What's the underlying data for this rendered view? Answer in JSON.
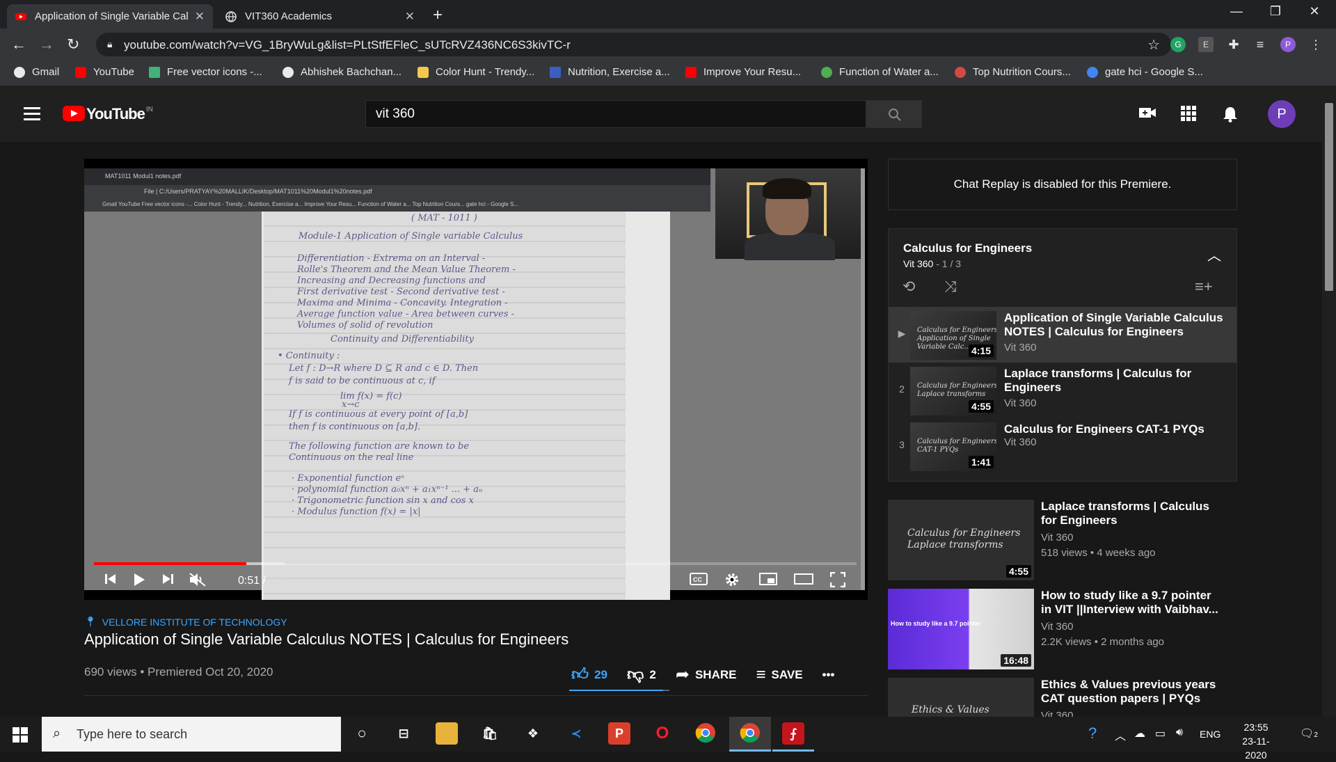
{
  "browser": {
    "tabs": [
      {
        "title": "Application of Single Variable Cal",
        "favicon": "youtube-icon",
        "active": true
      },
      {
        "title": "VIT360 Academics",
        "favicon": "globe-icon",
        "active": false
      }
    ],
    "new_tab": "+",
    "window_controls": {
      "minimize": "—",
      "maximize": "❐",
      "close": "✕"
    },
    "url": "youtube.com/watch?v=VG_1BryWuLg&list=PLtStfEFleC_sUTcRVZ436NC6S3kivTC-r",
    "extensions": [
      "G",
      "E"
    ],
    "profile_initial": "P",
    "bookmarks": [
      {
        "label": "Gmail",
        "color": "#e8eaed"
      },
      {
        "label": "YouTube",
        "color": "#ff0000"
      },
      {
        "label": "Free vector icons -...",
        "color": "#43b27a"
      },
      {
        "label": "Abhishek Bachchan...",
        "color": "#e8eaed"
      },
      {
        "label": "Color Hunt - Trendy...",
        "color": "#f2c94c"
      },
      {
        "label": "Nutrition, Exercise a...",
        "color": "#3b5fc0"
      },
      {
        "label": "Improve Your Resu...",
        "color": "#ff0000"
      },
      {
        "label": "Function of Water a...",
        "color": "#4caf50"
      },
      {
        "label": "Top Nutrition Cours...",
        "color": "#d24a43"
      },
      {
        "label": "gate hci - Google S...",
        "color": "#4285f4"
      }
    ]
  },
  "youtube": {
    "logo_text": "YouTube",
    "country": "IN",
    "search_value": "vit 360",
    "avatar_initial": "P"
  },
  "player": {
    "current_time": "0:51",
    "duration": "4:15",
    "progress_played": 0.2,
    "progress_loaded": 0.25,
    "inner_tab": "MAT1011 Modul1 notes.pdf",
    "inner_url": "File | C:/Users/PRATYAY%20MALLIK/Desktop/MAT1011%20Modul1%20notes.pdf",
    "inner_bookmarks": "Gmail   YouTube   Free vector icons -...   Color Hunt - Trendy...   Nutrition, Exercise a...   Improve Your Resu...   Function of Water a...   Top Nutrition Cours...   gate hci - Google S...",
    "notes": [
      "( MAT - 1011 )",
      "Module-1 Application of Single variable Calculus",
      "Differentiation - Extrema on an Interval -",
      "Rolle's Theorem and the Mean Value Theorem -",
      "Increasing and Decreasing functions and",
      "First derivative test - Second derivative test -",
      "Maxima and Minima - Concavity. Integration -",
      "Average function value - Area between curves -",
      "Volumes of solid of revolution",
      "Continuity and Differentiability",
      "• Continuity :",
      "Let f : D→R where D ⊆ R and c ∈ D. Then",
      "f is said to be continuous at c, if",
      "lim f(x) = f(c)",
      "x→c",
      "If f is continuous at every point of [a,b]",
      "then f is continuous on [a,b].",
      "The following function are known to be",
      "Continuous on the real line",
      "· Exponential function eˣ",
      "· polynomial function a₀xⁿ + a₁xⁿ⁻¹ ... + aₙ",
      "· Trigonometric function sin x and cos x",
      "· Modulus function f(x) = |x|"
    ]
  },
  "video": {
    "location": "VELLORE INSTITUTE OF TECHNOLOGY",
    "title": "Application of Single Variable Calculus NOTES | Calculus for Engineers",
    "meta": "690 views • Premiered Oct 20, 2020",
    "likes": "29",
    "dislikes": "2",
    "share_label": "SHARE",
    "save_label": "SAVE",
    "more_label": "•••"
  },
  "chat": {
    "text": "Chat Replay is disabled for this Premiere."
  },
  "playlist": {
    "title": "Calculus for Engineers",
    "channel": "Vit 360",
    "position": "1 / 3",
    "items": [
      {
        "index": "▶",
        "title": "Application of Single Variable Calculus NOTES | Calculus for Engineers",
        "channel": "Vit 360",
        "duration": "4:15",
        "thumb_text": "Calculus for Engineers\nApplication of Single\nVariable Calc..."
      },
      {
        "index": "2",
        "title": "Laplace transforms | Calculus for Engineers",
        "channel": "Vit 360",
        "duration": "4:55",
        "thumb_text": "Calculus for Engineers\nLaplace transforms"
      },
      {
        "index": "3",
        "title": "Calculus for Engineers CAT-1 PYQs",
        "channel": "Vit 360",
        "duration": "1:41",
        "thumb_text": "Calculus for Engineers\nCAT-1 PYQs"
      }
    ]
  },
  "recommendations": [
    {
      "title": "Laplace transforms | Calculus for Engineers",
      "channel": "Vit 360",
      "meta": "518 views • 4 weeks ago",
      "duration": "4:55",
      "thumb_text": "Calculus for Engineers\nLaplace transforms",
      "thumb_color": "#2e2e2e"
    },
    {
      "title": "How to study like a 9.7 pointer in VIT ||Interview with Vaibhav...",
      "channel": "Vit 360",
      "meta": "2.2K views • 2 months ago",
      "duration": "16:48",
      "thumb_text": "How to study like a 9.7 pointer",
      "thumb_color": "#5b2bd6"
    },
    {
      "title": "Ethics & Values previous years CAT question papers | PYQs",
      "channel": "Vit 360",
      "meta": "",
      "duration": "",
      "thumb_text": "Ethics & Values",
      "thumb_color": "#2e2e2e"
    }
  ],
  "taskbar": {
    "search_placeholder": "Type here to search",
    "language": "ENG",
    "time": "23:55",
    "date": "23-11-2020",
    "notification_count": "2"
  }
}
